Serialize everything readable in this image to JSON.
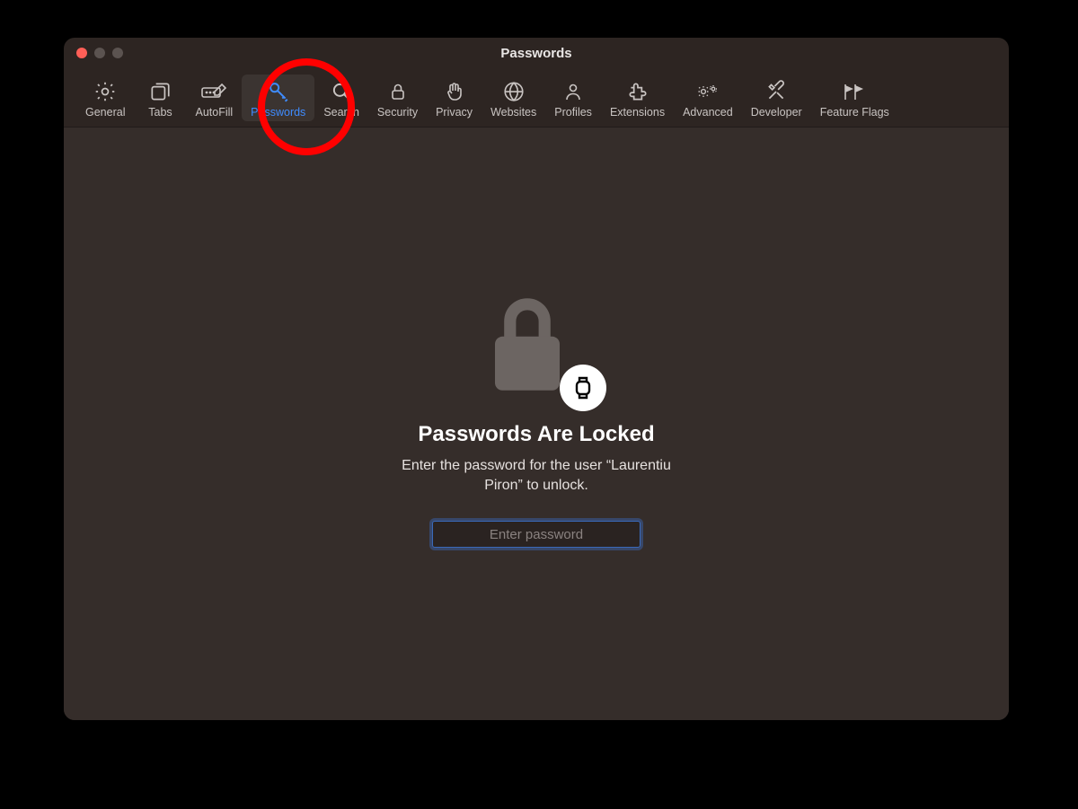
{
  "window": {
    "title": "Passwords"
  },
  "toolbar": {
    "items": [
      {
        "id": "general",
        "label": "General"
      },
      {
        "id": "tabs",
        "label": "Tabs"
      },
      {
        "id": "autofill",
        "label": "AutoFill"
      },
      {
        "id": "passwords",
        "label": "Passwords",
        "active": true
      },
      {
        "id": "search",
        "label": "Search"
      },
      {
        "id": "security",
        "label": "Security"
      },
      {
        "id": "privacy",
        "label": "Privacy"
      },
      {
        "id": "websites",
        "label": "Websites"
      },
      {
        "id": "profiles",
        "label": "Profiles"
      },
      {
        "id": "extensions",
        "label": "Extensions"
      },
      {
        "id": "advanced",
        "label": "Advanced"
      },
      {
        "id": "developer",
        "label": "Developer"
      },
      {
        "id": "featureflags",
        "label": "Feature Flags"
      }
    ]
  },
  "locked": {
    "title": "Passwords Are Locked",
    "subtitle": "Enter the password for the user “Laurentiu Piron” to unlock.",
    "placeholder": "Enter password"
  },
  "annotation": {
    "highlight": "passwords-tab-circle"
  }
}
